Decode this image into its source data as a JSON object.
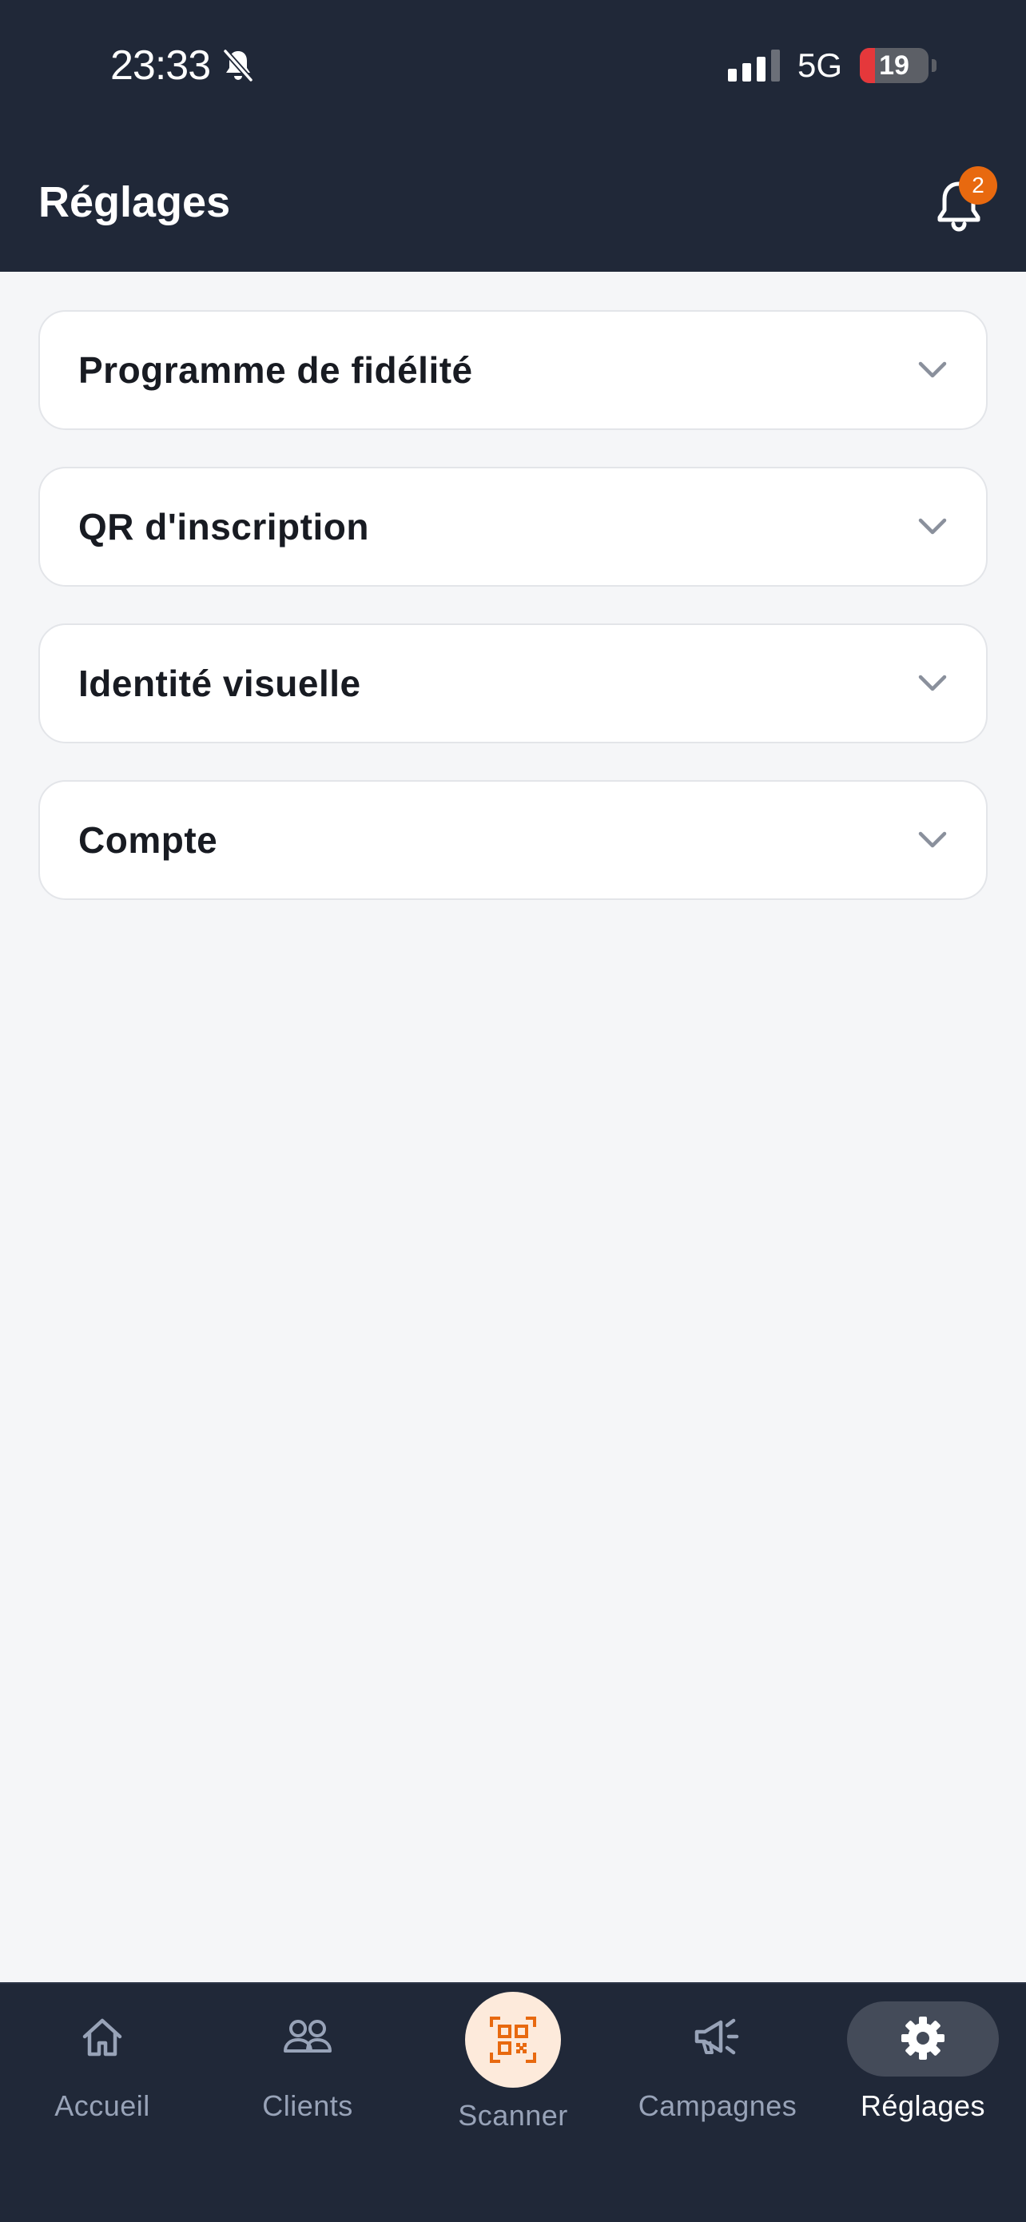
{
  "status_bar": {
    "time": "23:33",
    "network": "5G",
    "battery": "19"
  },
  "header": {
    "title": "Réglages",
    "notification_count": "2"
  },
  "sections": [
    {
      "label": "Programme de fidélité"
    },
    {
      "label": "QR d'inscription"
    },
    {
      "label": "Identité visuelle"
    },
    {
      "label": "Compte"
    }
  ],
  "tabbar": {
    "items": [
      {
        "label": "Accueil",
        "icon": "home-icon"
      },
      {
        "label": "Clients",
        "icon": "users-icon"
      },
      {
        "label": "Scanner",
        "icon": "qr-scan-icon"
      },
      {
        "label": "Campagnes",
        "icon": "megaphone-icon"
      },
      {
        "label": "Réglages",
        "icon": "gear-icon"
      }
    ],
    "active": "Réglages"
  },
  "colors": {
    "header_bg": "#202838",
    "accent": "#e8690f",
    "background": "#f5f6f8"
  }
}
